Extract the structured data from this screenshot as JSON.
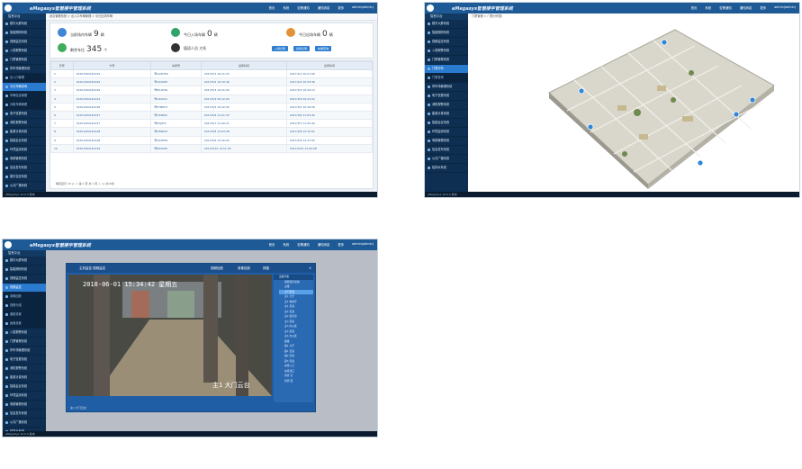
{
  "app": {
    "title": "eMegasys智慧楼宇管理系统",
    "top_nav": [
      "首页",
      "系统",
      "告警通知",
      "通知消息",
      "更多",
      "admin(admin)"
    ],
    "status_bar": "eMegaSys 10.0.9  版本"
  },
  "colors": {
    "header": "#1d5a96",
    "sidebar": "#0e2f52",
    "accent": "#2f7fd1"
  },
  "screen1": {
    "breadcrumb": "综合管理系统 > 出入口车辆管理 > 今日出场车辆",
    "sidebar_header": "智慧平台",
    "sidebar": [
      "楼宇大屏系统",
      "智能照明系统",
      "视频监控系统",
      "入侵报警系统",
      "门禁管理系统",
      "停车场管理系统",
      "出入口管理",
      "今日车辆查询",
      "车辆信息管理",
      "月租车辆管理",
      "电子巡更系统",
      "消防报警系统",
      "能源计量系统",
      "智能会议系统",
      "环境监测系统",
      "电梯管理系统",
      "信息发布系统",
      "楼宇自控系统",
      "公共广播系统",
      "给排水系统"
    ],
    "stats": [
      {
        "label": "当前场内车辆",
        "value": "9",
        "unit": "辆"
      },
      {
        "label": "今日入场车辆",
        "value": "0",
        "unit": "辆"
      },
      {
        "label": "今日出场车辆",
        "value": "0",
        "unit": "辆"
      },
      {
        "label": "剩余车位",
        "value": "345",
        "unit": "个"
      },
      {
        "label": "值班人员",
        "value": "大托",
        "unit": ""
      }
    ],
    "buttons": [
      "入场记录",
      "出场记录",
      "车辆查询"
    ],
    "table": {
      "headers": [
        "序号",
        "卡号",
        "车牌号",
        "进场时间",
        "出场时间"
      ],
      "rows": [
        [
          "1",
          "31201302161215",
          "粤GA5H56",
          "2017/5/1 10:21:33",
          "2017/5/1 10:21:56"
        ],
        [
          "2",
          "31201302161215",
          "粤C02X85",
          "2017/5/2 10:32:40",
          "2017/5/2 10:33:36"
        ],
        [
          "3",
          "31201302161216",
          "粤B31H39",
          "2017/5/3 10:41:02",
          "2017/5/3 10:44:13"
        ],
        [
          "4",
          "31201302161214",
          "粤A32C01",
          "2017/5/4 09:12:03",
          "2017/5/4 09:23:22"
        ],
        [
          "5",
          "31201302161216",
          "粤E7B6T0",
          "2017/5/5 10:42:09",
          "2017/5/5 10:49:56"
        ],
        [
          "6",
          "31201302161217",
          "粤C32E62",
          "2017/5/6 11:01:33",
          "2017/5/6 11:03:45"
        ],
        [
          "7",
          "31201302161217",
          "粤E3J9T5",
          "2017/5/7 11:20:11",
          "2017/5/7 11:25:40"
        ],
        [
          "8",
          "31201302161218",
          "粤D56P23",
          "2017/5/8 12:03:28",
          "2017/5/8 12:10:51"
        ],
        [
          "9",
          "31201302161218",
          "粤C02H56",
          "2017/5/9 12:40:02",
          "2017/5/9 12:47:55"
        ],
        [
          "10",
          "31201302161219",
          "粤B22C85",
          "2017/5/10 13:11:45",
          "2017/5/10 13:20:08"
        ]
      ]
    },
    "pager": "每页显示 10   |<  <  第 1 页 共 1 页  >  >|  共10条"
  },
  "screen2": {
    "breadcrumb": "门禁管理 > 门禁分布图",
    "sidebar_header": "智慧平台",
    "sidebar": [
      "楼宇大屏系统",
      "智能照明系统",
      "视频监控系统",
      "入侵报警系统",
      "门禁管理系统",
      "门禁分布",
      "门禁查询",
      "停车场管理系统",
      "电子巡更系统",
      "消防报警系统",
      "能源计量系统",
      "智能会议系统",
      "环境监测系统",
      "电梯管理系统",
      "信息发布系统",
      "公共广播系统",
      "给排水系统"
    ],
    "status_bar": "eMegaSys 10.0.9  版本"
  },
  "screen3": {
    "window_title": "主机监控  视频监控",
    "toolbar": [
      "视频回放",
      "录像回放",
      "抓图"
    ],
    "osd_time": "2018-06-01 15:34:42 星期五",
    "osd_camera": "主1 大门云台",
    "footer_label": "主1 大门云台",
    "tree_header": "设备列表",
    "tree": [
      "视频监控系统",
      "主楼",
      "大门云台",
      "主1 大厅",
      "主1 电梯厅",
      "主1 走廊",
      "主2 走廊",
      "主2 会议室",
      "主3 走廊",
      "主3 办公区",
      "主4 走廊",
      "主4 办公区",
      "副楼",
      "副1 大厅",
      "副1 走廊",
      "副2 走廊",
      "副3 走廊",
      "车库入口",
      "车库出口",
      "周界 东",
      "周界 西"
    ],
    "sidebar": [
      "楼宇大屏系统",
      "智能照明系统",
      "视频监控系统",
      "视频监控",
      "录像回放",
      "视频分组",
      "通道设置",
      "画面设置",
      "入侵报警系统",
      "门禁管理系统",
      "停车场管理系统",
      "电子巡更系统",
      "消防报警系统",
      "能源计量系统",
      "智能会议系统",
      "环境监测系统",
      "电梯管理系统",
      "信息发布系统",
      "公共广播系统",
      "给排水系统"
    ]
  }
}
